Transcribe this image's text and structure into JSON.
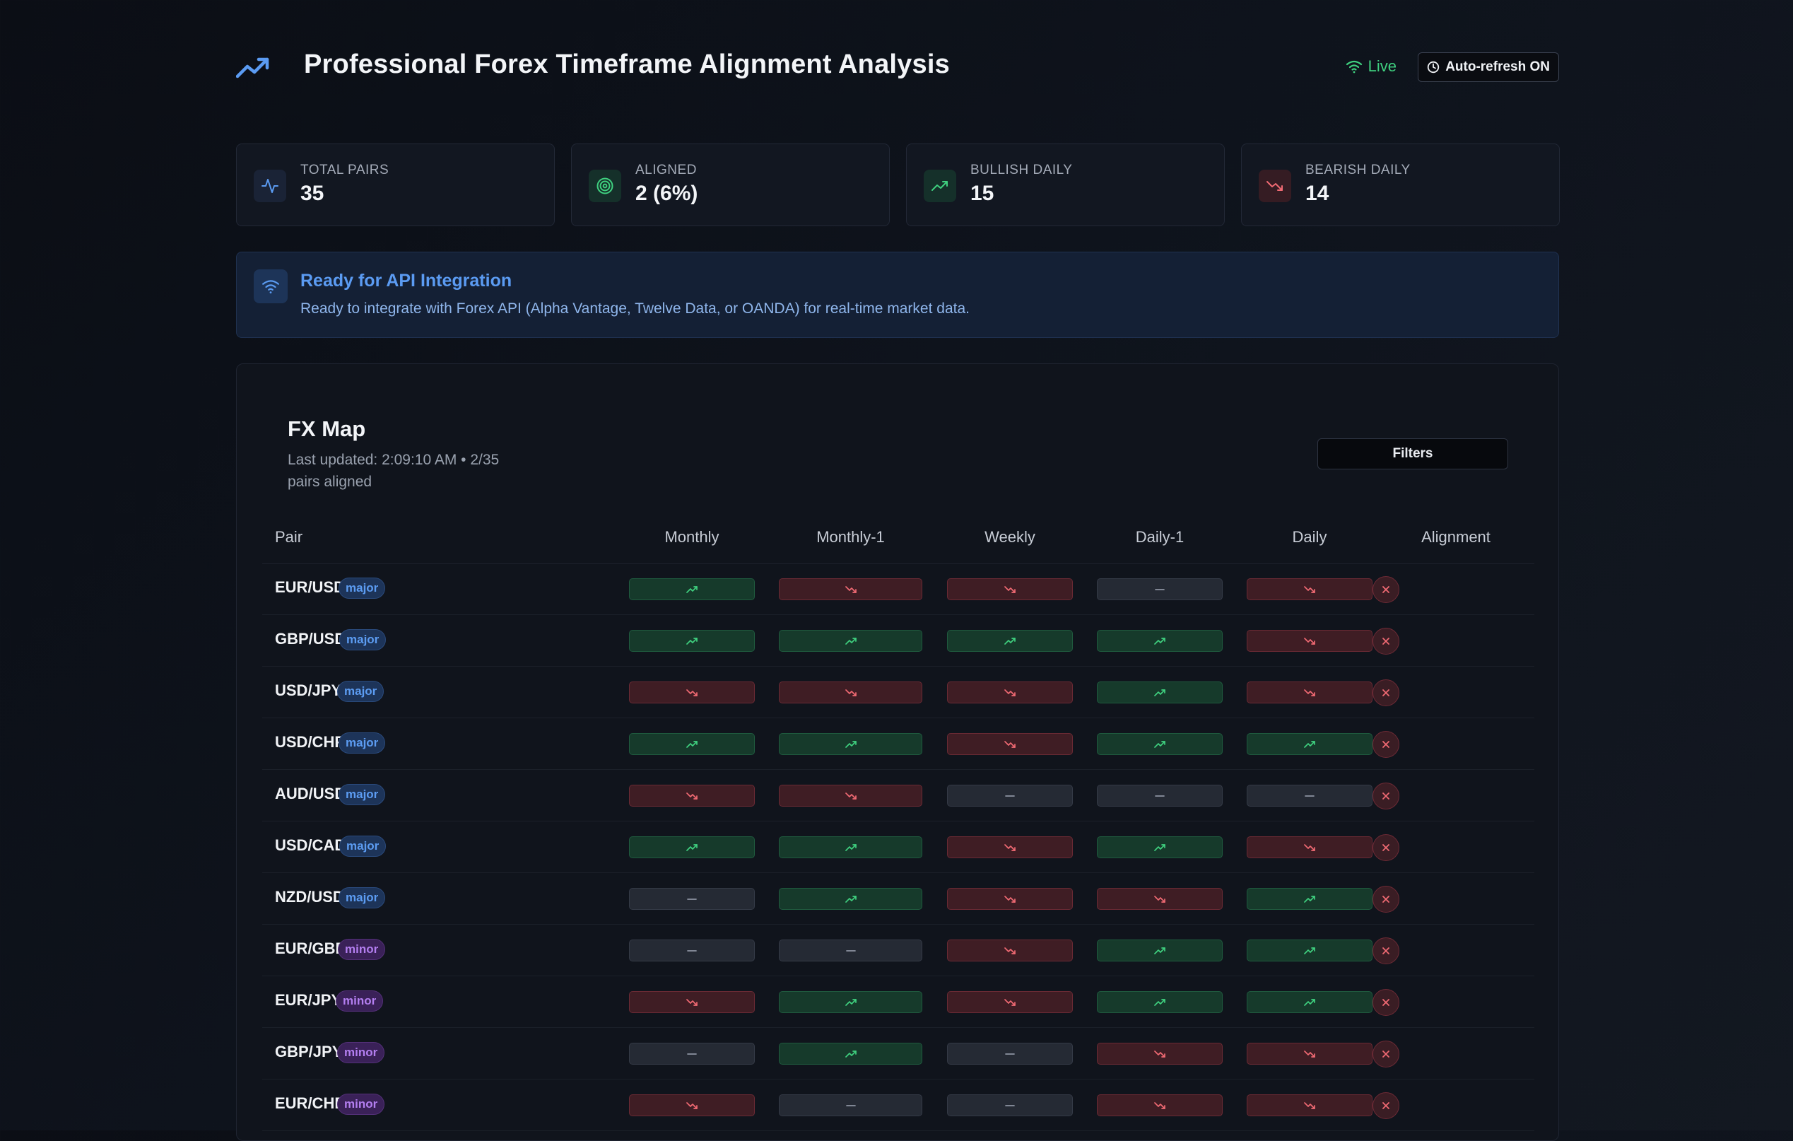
{
  "header": {
    "title": "Professional Forex Timeframe Alignment Analysis",
    "live_label": "Live",
    "autorefresh_label": "Auto-refresh ON"
  },
  "stats": [
    {
      "label": "TOTAL PAIRS",
      "value": "35",
      "icon": "activity-icon",
      "color": "#5b9bf2"
    },
    {
      "label": "ALIGNED",
      "value": "2 (6%)",
      "icon": "target-icon",
      "color": "#3fd07f"
    },
    {
      "label": "BULLISH DAILY",
      "value": "15",
      "icon": "trending-up-icon",
      "color": "#3fd07f"
    },
    {
      "label": "BEARISH DAILY",
      "value": "14",
      "icon": "trending-down-icon",
      "color": "#f06a73"
    }
  ],
  "api_banner": {
    "title": "Ready for API Integration",
    "description": "Ready to integrate with Forex API (Alpha Vantage, Twelve Data, or OANDA) for real-time market data."
  },
  "fx_map": {
    "title": "FX Map",
    "subtitle": "Last updated: 2:09:10 AM • 2/35 pairs aligned",
    "filters_label": "Filters",
    "columns": [
      "Pair",
      "Monthly",
      "Monthly-1",
      "Weekly",
      "Daily-1",
      "Daily",
      "Alignment"
    ],
    "rows": [
      {
        "pair": "EUR/USD",
        "category": "major",
        "trends": [
          "up",
          "down",
          "down",
          "flat",
          "down"
        ],
        "aligned": false
      },
      {
        "pair": "GBP/USD",
        "category": "major",
        "trends": [
          "up",
          "up",
          "up",
          "up",
          "down"
        ],
        "aligned": false
      },
      {
        "pair": "USD/JPY",
        "category": "major",
        "trends": [
          "down",
          "down",
          "down",
          "up",
          "down"
        ],
        "aligned": false
      },
      {
        "pair": "USD/CHF",
        "category": "major",
        "trends": [
          "up",
          "up",
          "down",
          "up",
          "up"
        ],
        "aligned": false
      },
      {
        "pair": "AUD/USD",
        "category": "major",
        "trends": [
          "down",
          "down",
          "flat",
          "flat",
          "flat"
        ],
        "aligned": false
      },
      {
        "pair": "USD/CAD",
        "category": "major",
        "trends": [
          "up",
          "up",
          "down",
          "up",
          "down"
        ],
        "aligned": false
      },
      {
        "pair": "NZD/USD",
        "category": "major",
        "trends": [
          "flat",
          "up",
          "down",
          "down",
          "up"
        ],
        "aligned": false
      },
      {
        "pair": "EUR/GBP",
        "category": "minor",
        "trends": [
          "flat",
          "flat",
          "down",
          "up",
          "up"
        ],
        "aligned": false
      },
      {
        "pair": "EUR/JPY",
        "category": "minor",
        "trends": [
          "down",
          "up",
          "down",
          "up",
          "up"
        ],
        "aligned": false
      },
      {
        "pair": "GBP/JPY",
        "category": "minor",
        "trends": [
          "flat",
          "up",
          "flat",
          "down",
          "down"
        ],
        "aligned": false
      },
      {
        "pair": "EUR/CHF",
        "category": "minor",
        "trends": [
          "down",
          "flat",
          "flat",
          "down",
          "down"
        ],
        "aligned": false
      }
    ]
  },
  "colors": {
    "bullish": "#3fd07f",
    "bearish": "#f06a73",
    "neutral": "#8d94a1",
    "major_tag": "#5c9cf2",
    "minor_tag": "#b37ef0"
  }
}
